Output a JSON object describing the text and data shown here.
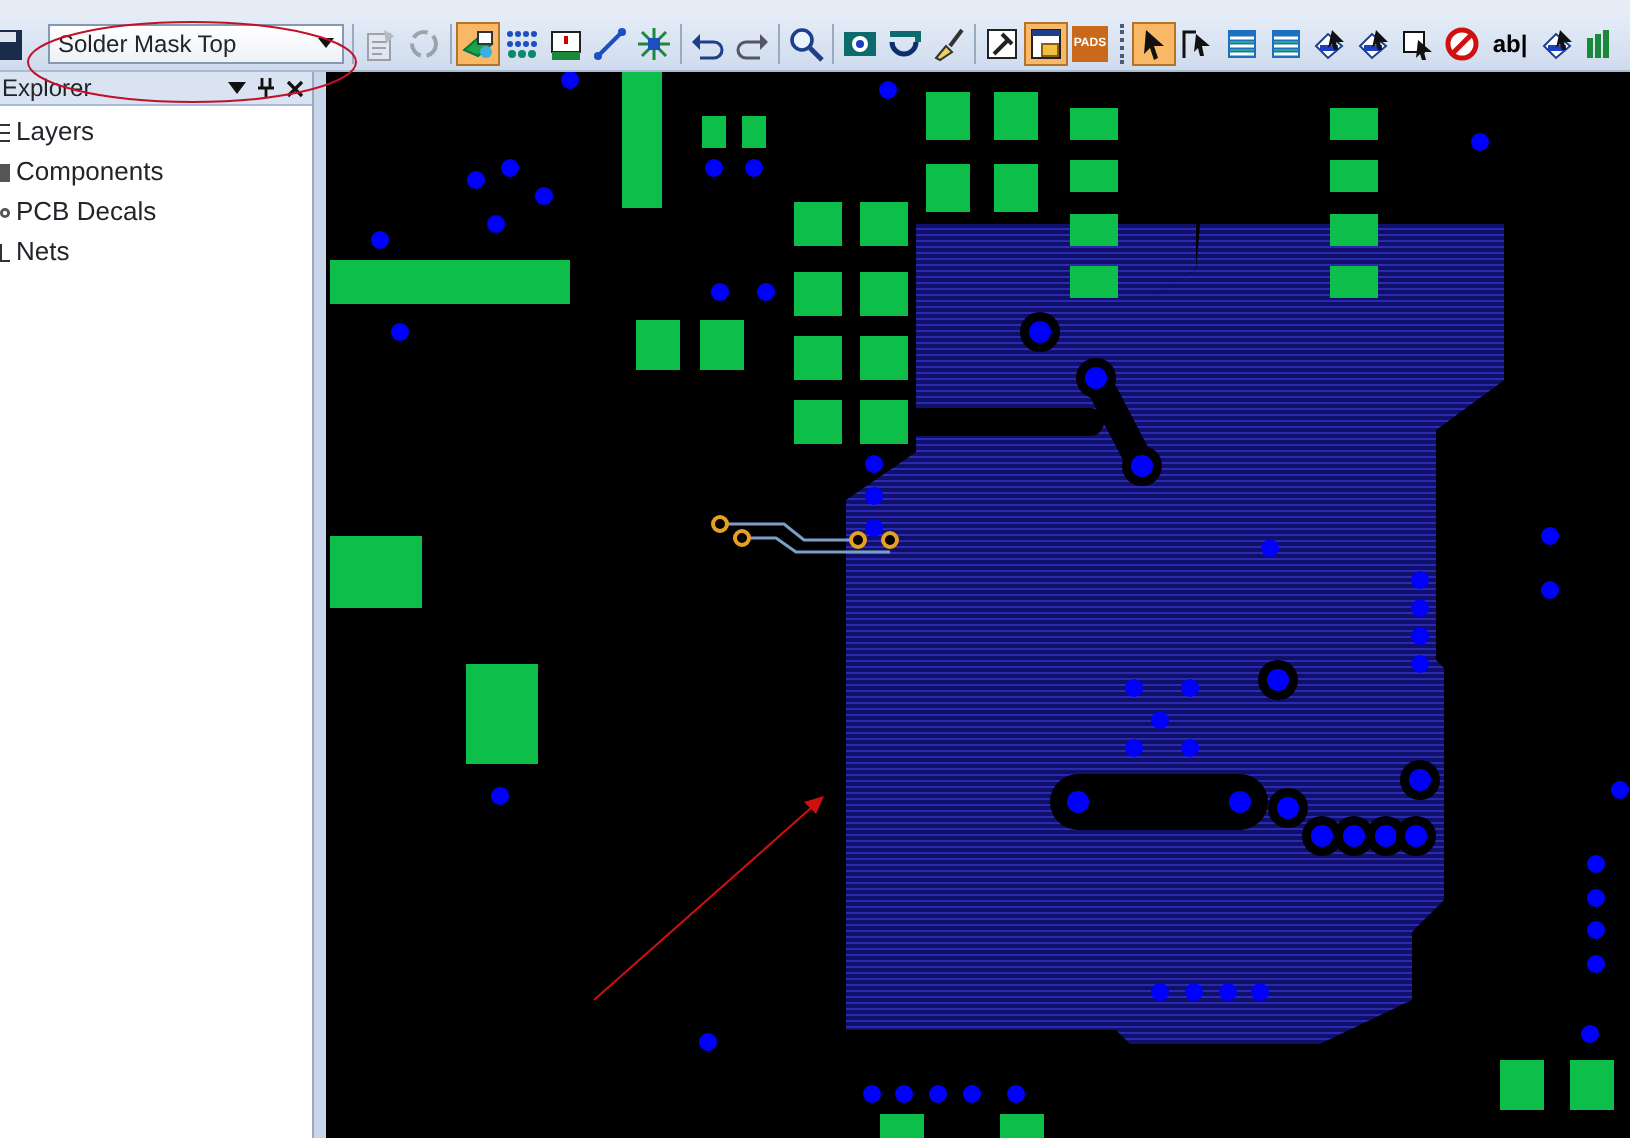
{
  "toolbar": {
    "save": {
      "kind": "save",
      "selected": false,
      "disabled": false
    },
    "layer_select": {
      "value": "Solder Mask Top"
    },
    "buttons": [
      {
        "kind": "separator"
      },
      {
        "kind": "properties",
        "selected": false,
        "disabled": true
      },
      {
        "kind": "refresh",
        "selected": false,
        "disabled": true
      },
      {
        "kind": "separator"
      },
      {
        "kind": "layer-pick",
        "selected": true,
        "disabled": false
      },
      {
        "kind": "plane",
        "selected": false,
        "disabled": false
      },
      {
        "kind": "board",
        "selected": false,
        "disabled": false
      },
      {
        "kind": "line",
        "selected": false,
        "disabled": false
      },
      {
        "kind": "cluster",
        "selected": false,
        "disabled": false
      },
      {
        "kind": "separator"
      },
      {
        "kind": "undo",
        "selected": false,
        "disabled": false
      },
      {
        "kind": "redo",
        "selected": false,
        "disabled": false
      },
      {
        "kind": "separator"
      },
      {
        "kind": "zoom",
        "selected": false,
        "disabled": false
      },
      {
        "kind": "separator"
      },
      {
        "kind": "view-zoom",
        "selected": false,
        "disabled": false
      },
      {
        "kind": "rotate",
        "selected": false,
        "disabled": false
      },
      {
        "kind": "brush",
        "selected": false,
        "disabled": false
      },
      {
        "kind": "separator"
      },
      {
        "kind": "hammer",
        "selected": false,
        "disabled": false
      },
      {
        "kind": "window",
        "selected": true,
        "disabled": false
      },
      {
        "kind": "logo",
        "label": "PADS",
        "selected": false,
        "disabled": false
      },
      {
        "kind": "grip"
      },
      {
        "kind": "select",
        "selected": true,
        "disabled": false
      },
      {
        "kind": "select-corner",
        "selected": false,
        "disabled": false
      },
      {
        "kind": "stack",
        "selected": false,
        "disabled": false
      },
      {
        "kind": "stack",
        "selected": false,
        "disabled": false
      },
      {
        "kind": "select-part",
        "selected": false,
        "disabled": false
      },
      {
        "kind": "select-part",
        "selected": false,
        "disabled": false
      },
      {
        "kind": "select-shape",
        "selected": false,
        "disabled": false
      },
      {
        "kind": "no-entry",
        "selected": false,
        "disabled": false
      },
      {
        "kind": "text",
        "label": "ab|",
        "selected": false,
        "disabled": false
      },
      {
        "kind": "select-part",
        "selected": false,
        "disabled": false
      },
      {
        "kind": "bars",
        "selected": false,
        "disabled": false
      }
    ]
  },
  "explorer": {
    "title": "Explorer",
    "items": [
      {
        "kind": "layers",
        "label": "Layers"
      },
      {
        "kind": "components",
        "label": "Components"
      },
      {
        "kind": "decals",
        "label": "PCB Decals"
      },
      {
        "kind": "nets",
        "label": "Nets"
      }
    ]
  }
}
